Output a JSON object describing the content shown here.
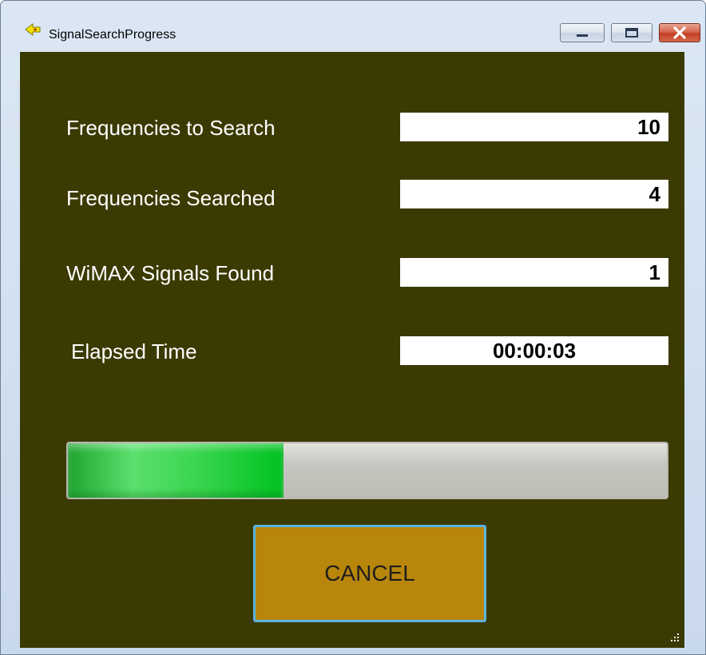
{
  "window": {
    "title": "SignalSearchProgress",
    "icons": {
      "app": "app-icon",
      "minimize": "minimize-icon",
      "maximize": "maximize-icon",
      "close": "close-icon",
      "resize": "resize-grip-icon"
    }
  },
  "fields": [
    {
      "label": "Frequencies to Search",
      "value": "10"
    },
    {
      "label": "Frequencies Searched",
      "value": "4"
    },
    {
      "label": "WiMAX Signals Found",
      "value": "1"
    },
    {
      "label": "Elapsed Time",
      "value": "00:00:03"
    }
  ],
  "progress": {
    "fraction": 0.36
  },
  "cancel_button": {
    "label": "CANCEL"
  },
  "colors": {
    "client_background": "#3b3a02",
    "progress_fill": "#00c221",
    "cancel_button_background": "#b8860b",
    "cancel_button_border": "#5ab4e0"
  }
}
